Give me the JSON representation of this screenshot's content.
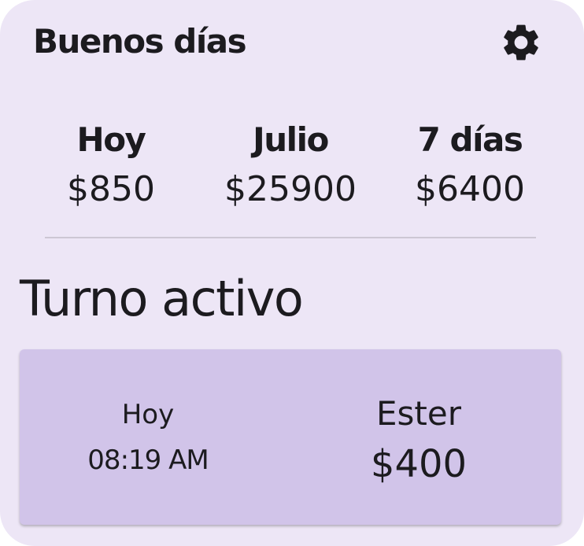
{
  "header": {
    "greeting": "Buenos días",
    "settings_icon": "gear-icon"
  },
  "summary": {
    "items": [
      {
        "label": "Hoy",
        "value": "$850"
      },
      {
        "label": "Julio",
        "value": "$25900"
      },
      {
        "label": "7 días",
        "value": "$6400"
      }
    ]
  },
  "active_shift": {
    "title": "Turno activo",
    "day": "Hoy",
    "time": "08:19 AM",
    "name": "Ester",
    "amount": "$400"
  },
  "colors": {
    "widget_background": "#ede6f6",
    "card_background": "#d1c4e9",
    "text": "#1c1b1f",
    "divider": "#cdc7d4"
  }
}
